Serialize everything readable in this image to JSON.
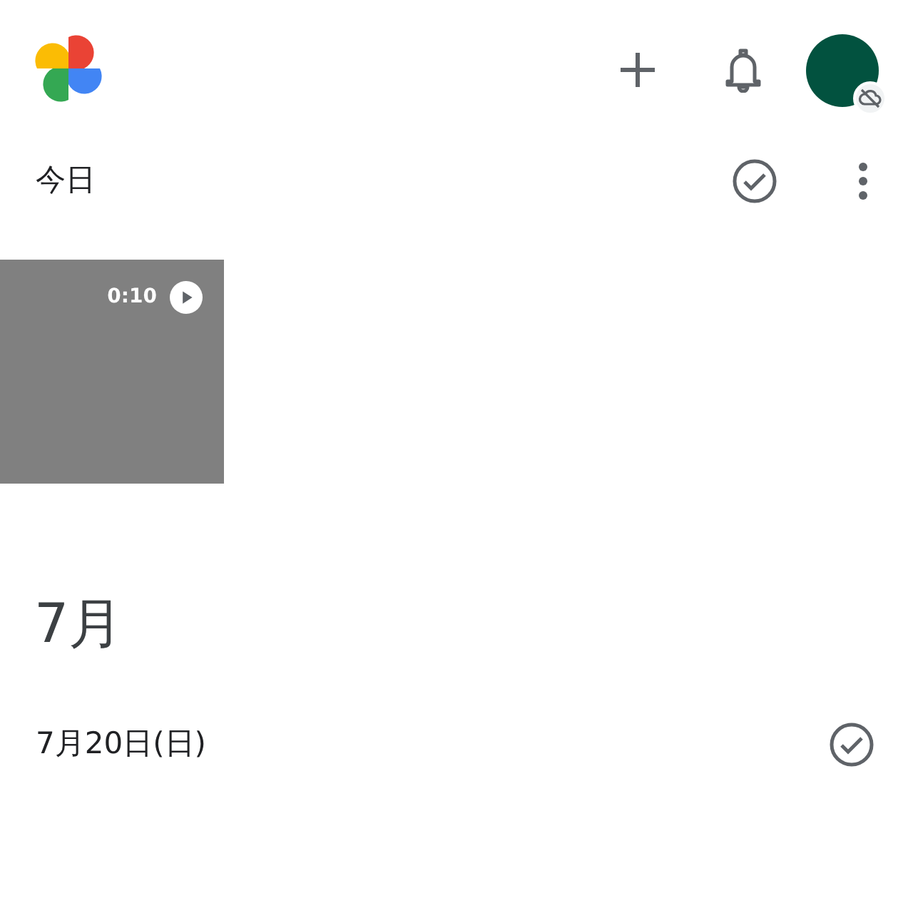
{
  "sections": [
    {
      "kind": "day",
      "title": "今日",
      "more_menu": true,
      "videos": [
        {
          "duration": "0:10"
        }
      ]
    },
    {
      "kind": "month",
      "title": "7月"
    },
    {
      "kind": "day",
      "title": "7月20日(日)",
      "more_menu": false
    }
  ]
}
